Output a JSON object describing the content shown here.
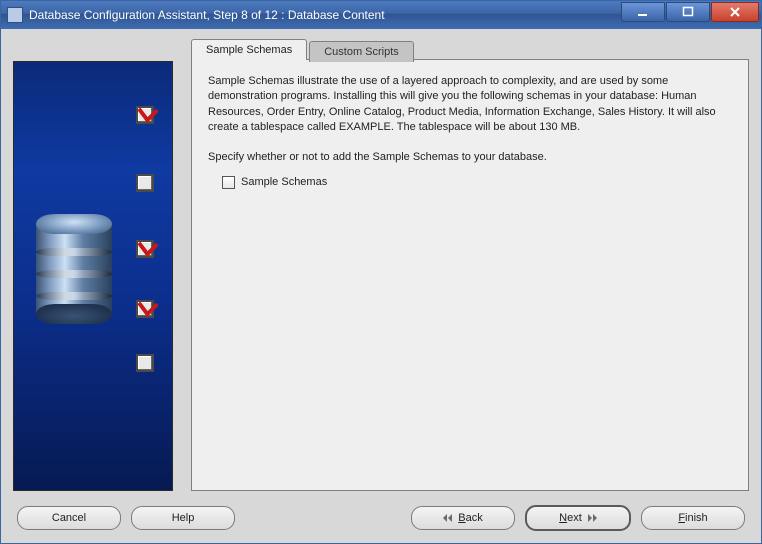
{
  "window": {
    "title": "Database Configuration Assistant, Step 8 of 12 : Database Content"
  },
  "tabs": [
    {
      "id": "sample",
      "label": "Sample Schemas",
      "active": true
    },
    {
      "id": "custom",
      "label": "Custom Scripts",
      "active": false
    }
  ],
  "content": {
    "description": "Sample Schemas illustrate the use of a layered approach to complexity, and are used by some demonstration programs. Installing this will give you the following schemas in your database: Human Resources, Order Entry, Online Catalog, Product Media, Information Exchange, Sales History. It will also create a tablespace called EXAMPLE. The tablespace will be about 130 MB.",
    "prompt": "Specify whether or not to add the Sample Schemas to your database.",
    "checkbox_label": "Sample Schemas",
    "checkbox_checked": false
  },
  "buttons": {
    "cancel": "Cancel",
    "help": "Help",
    "back": "Back",
    "next": "Next",
    "finish": "Finish"
  },
  "banner": {
    "steps": [
      {
        "checked": true
      },
      {
        "checked": false
      },
      {
        "checked": true
      },
      {
        "checked": true
      },
      {
        "checked": false
      }
    ]
  }
}
